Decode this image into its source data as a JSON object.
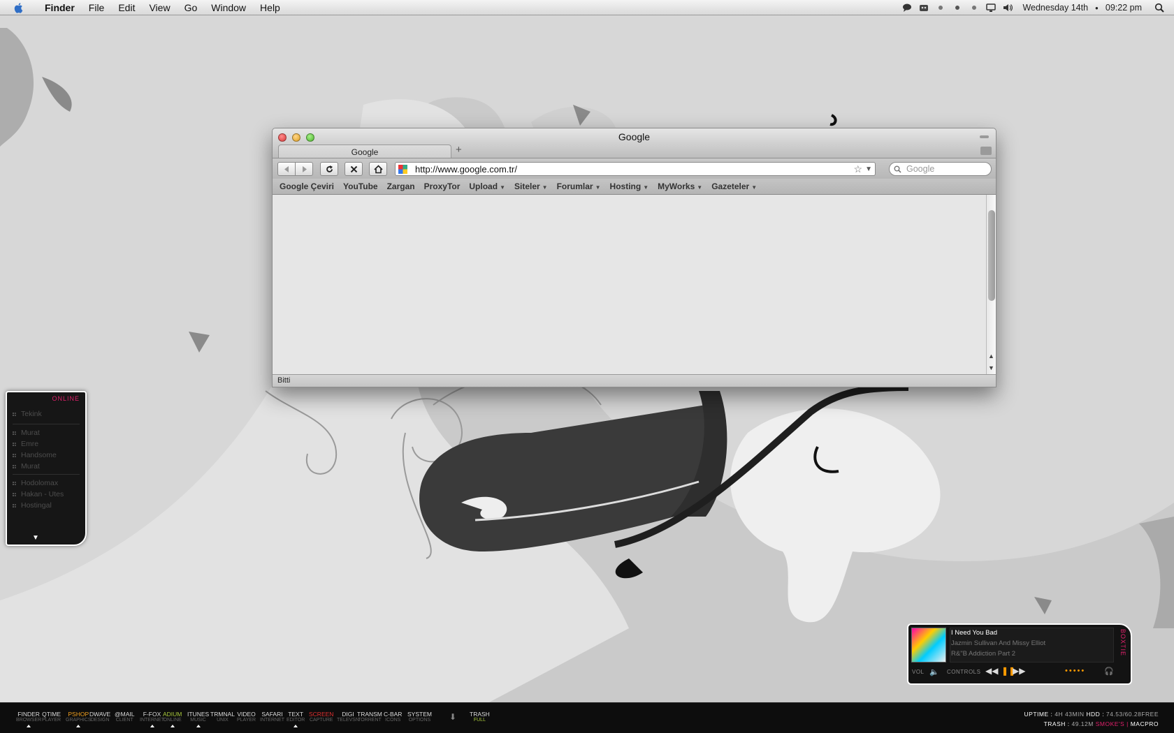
{
  "menubar": {
    "app": "Finder",
    "items": [
      "File",
      "Edit",
      "View",
      "Go",
      "Window",
      "Help"
    ],
    "date": "Wednesday 14th",
    "time": "09:22 pm"
  },
  "browser": {
    "window_title": "Google",
    "tab_title": "Google",
    "new_tab": "+",
    "url": "http://www.google.com.tr/",
    "search_placeholder": "Google",
    "bookmarks": [
      {
        "label": "Google Çeviri",
        "menu": false
      },
      {
        "label": "YouTube",
        "menu": false
      },
      {
        "label": "Zargan",
        "menu": false
      },
      {
        "label": "ProxyTor",
        "menu": false
      },
      {
        "label": "Upload",
        "menu": true
      },
      {
        "label": "Siteler",
        "menu": true
      },
      {
        "label": "Forumlar",
        "menu": true
      },
      {
        "label": "Hosting",
        "menu": true
      },
      {
        "label": "MyWorks",
        "menu": true
      },
      {
        "label": "Gazeteler",
        "menu": true
      }
    ],
    "status": "Bitti"
  },
  "buddy_list": {
    "status": "ONLINE",
    "groups": [
      [
        "Tekink"
      ],
      [
        "Murat",
        "Emre",
        "Handsome",
        "Murat"
      ],
      [
        "Hodolomax",
        "Hakan - Utes",
        "Hostingal"
      ]
    ]
  },
  "music": {
    "song": "I Need You Bad",
    "artist": "Jazmin Sullivan And Missy Elliot",
    "album": "R&\"B Addiction Part 2",
    "brand": "BOXTIE",
    "vol_label": "VOL",
    "controls_label": "CONTROLS"
  },
  "dock": [
    {
      "title": "FINDER",
      "sub": "BROWSER",
      "color": "#dddddd",
      "running": true
    },
    {
      "title": "QTIME",
      "sub": "PLAYER",
      "color": "#dddddd",
      "running": false
    },
    {
      "title": "PSHOP",
      "sub": "GRAPHICS",
      "color": "#f0a020",
      "running": true
    },
    {
      "title": "DWAVE",
      "sub": "DESIGN",
      "color": "#dddddd",
      "running": false
    },
    {
      "title": "@MAIL",
      "sub": "CLIENT",
      "color": "#dddddd",
      "running": false
    },
    {
      "title": "F-FOX",
      "sub": "INTERNET",
      "color": "#dddddd",
      "running": true
    },
    {
      "title": "ADIUM",
      "sub": "ONLINE",
      "color": "#a8c83c",
      "running": true
    },
    {
      "title": "ITUNES",
      "sub": "MUSIC",
      "color": "#dddddd",
      "running": true
    },
    {
      "title": "TRMNAL",
      "sub": "UNIX",
      "color": "#dddddd",
      "running": false
    },
    {
      "title": "VIDEO",
      "sub": "PLAYER",
      "color": "#dddddd",
      "running": false
    },
    {
      "title": "SAFARI",
      "sub": "INTERNET",
      "color": "#dddddd",
      "running": false
    },
    {
      "title": "TEXT",
      "sub": "EDITOR",
      "color": "#dddddd",
      "running": true
    },
    {
      "title": "SCREEN",
      "sub": "CAPTURE",
      "color": "#e03030",
      "running": false
    },
    {
      "title": "DIGI",
      "sub": "TELEVSN",
      "color": "#dddddd",
      "running": false
    },
    {
      "title": "TRANSM",
      "sub": "TORRENT",
      "color": "#dddddd",
      "running": false
    },
    {
      "title": "C-BAR",
      "sub": "ICONS",
      "color": "#dddddd",
      "running": false
    },
    {
      "title": "SYSTEM",
      "sub": "OPTIONS",
      "color": "#dddddd",
      "running": false
    }
  ],
  "trash": {
    "title": "TRASH",
    "sub": "FULL"
  },
  "stats": {
    "uptime_label": "UPTIME",
    "uptime": "4H 43MIN",
    "hdd_label": "HDD",
    "hdd": "74.53/60.28FREE",
    "trash_label": "TRASH",
    "trash": "49.12M",
    "owner": "SMOKE'S",
    "machine": "MACPRO"
  }
}
